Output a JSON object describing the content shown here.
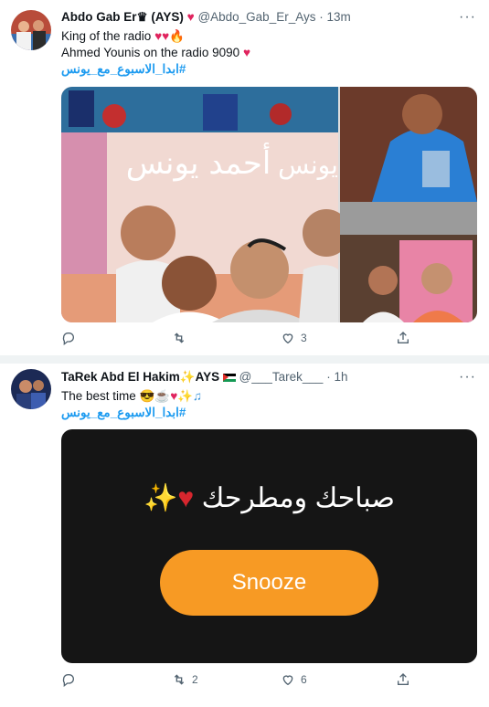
{
  "tweets": [
    {
      "name": "Abdo Gab Er",
      "name_suffix": "♛ (AYS)",
      "handle": "@Abdo_Gab_Er_Ays",
      "time": "13m",
      "line1": "King of the radio",
      "line2": "Ahmed Younis on the radio 9090",
      "hashtag": "#ابدا_الاسبوع_مع_يونس",
      "image_text_main": "أحمد يونس",
      "image_text_side": "يونس",
      "reply_count": "",
      "retweet_count": "",
      "like_count": "3"
    },
    {
      "name": "TaRek Abd El Hakim",
      "name_suffix": "AYS",
      "handle": "@___Tarek___",
      "time": "1h",
      "line1": "The best time",
      "hashtag": "#ابدا_الاسبوع_مع_يونس",
      "media_text": "صباحك ومطرحك",
      "snooze_label": "Snooze",
      "reply_count": "",
      "retweet_count": "2",
      "like_count": "6"
    }
  ],
  "separator": "·",
  "icons": [
    "reply-icon",
    "retweet-icon",
    "like-icon",
    "share-icon",
    "more-icon",
    "verified-crown-icon"
  ],
  "colors": {
    "link": "#1d9bf0",
    "meta": "#536471",
    "snooze": "#f79a24",
    "heart": "#e0245e"
  }
}
